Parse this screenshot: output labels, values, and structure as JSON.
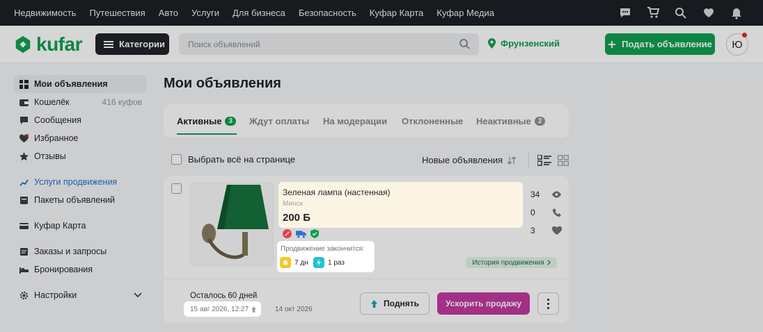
{
  "topnav": {
    "links": [
      "Недвижимость",
      "Путешествия",
      "Авто",
      "Услуги",
      "Для бизнеса",
      "Безопасность",
      "Куфар Карта",
      "Куфар Медиа"
    ],
    "icons": [
      "chat-icon",
      "cart-icon",
      "compare-icon",
      "heart-icon",
      "bell-icon"
    ]
  },
  "header": {
    "logo": "kufar",
    "categories_label": "Категории",
    "search_placeholder": "Поиск объявлений",
    "region": "Фрунзенский",
    "post_label": "Подать объявление",
    "avatar_letter": "Ю",
    "brand_color": "#10a050"
  },
  "sidebar": {
    "items": [
      {
        "label": "Мои объявления",
        "icon": "grid-icon",
        "active": true
      },
      {
        "label": "Кошелёк",
        "icon": "wallet-icon",
        "meta": "416 куфов"
      },
      {
        "label": "Сообщения",
        "icon": "chat-icon"
      },
      {
        "label": "Избранное",
        "icon": "heart-icon"
      },
      {
        "label": "Отзывы",
        "icon": "star-icon"
      },
      {
        "label": "Услуги продвижения",
        "icon": "trend-icon"
      },
      {
        "label": "Пакеты объявлений",
        "icon": "package-icon"
      },
      {
        "label": "Куфар Карта",
        "icon": "card-icon"
      },
      {
        "label": "Заказы и запросы",
        "icon": "orders-icon"
      },
      {
        "label": "Бронирования",
        "icon": "bed-icon"
      },
      {
        "label": "Настройки",
        "icon": "gear-icon"
      }
    ]
  },
  "main": {
    "title": "Мои объявления",
    "tabs": [
      {
        "label": "Активные",
        "count": "3"
      },
      {
        "label": "Ждут оплаты"
      },
      {
        "label": "На модерации"
      },
      {
        "label": "Отклоненные"
      },
      {
        "label": "Неактивные",
        "count": "2"
      }
    ],
    "select_all": "Выбрать всё на странице",
    "sort": "Новые объявления",
    "ad": {
      "title": "Зеленая лампа (настенная)",
      "city": "Минск",
      "price": "200 Б",
      "views": "34",
      "calls": "0",
      "favorites": "3",
      "promo_label": "Продвижение закончится:",
      "promo_days": "7 дн",
      "promo_times": "1 раз",
      "history_label": "История продвижения",
      "remaining": "Осталось 60 дней",
      "date_created": "15 авг 2026, 12:27",
      "date_end": "14 окт 2026",
      "raise_label": "Поднять",
      "boost_label": "Ускорить продажу",
      "boost_color": "#c23aa0"
    }
  }
}
